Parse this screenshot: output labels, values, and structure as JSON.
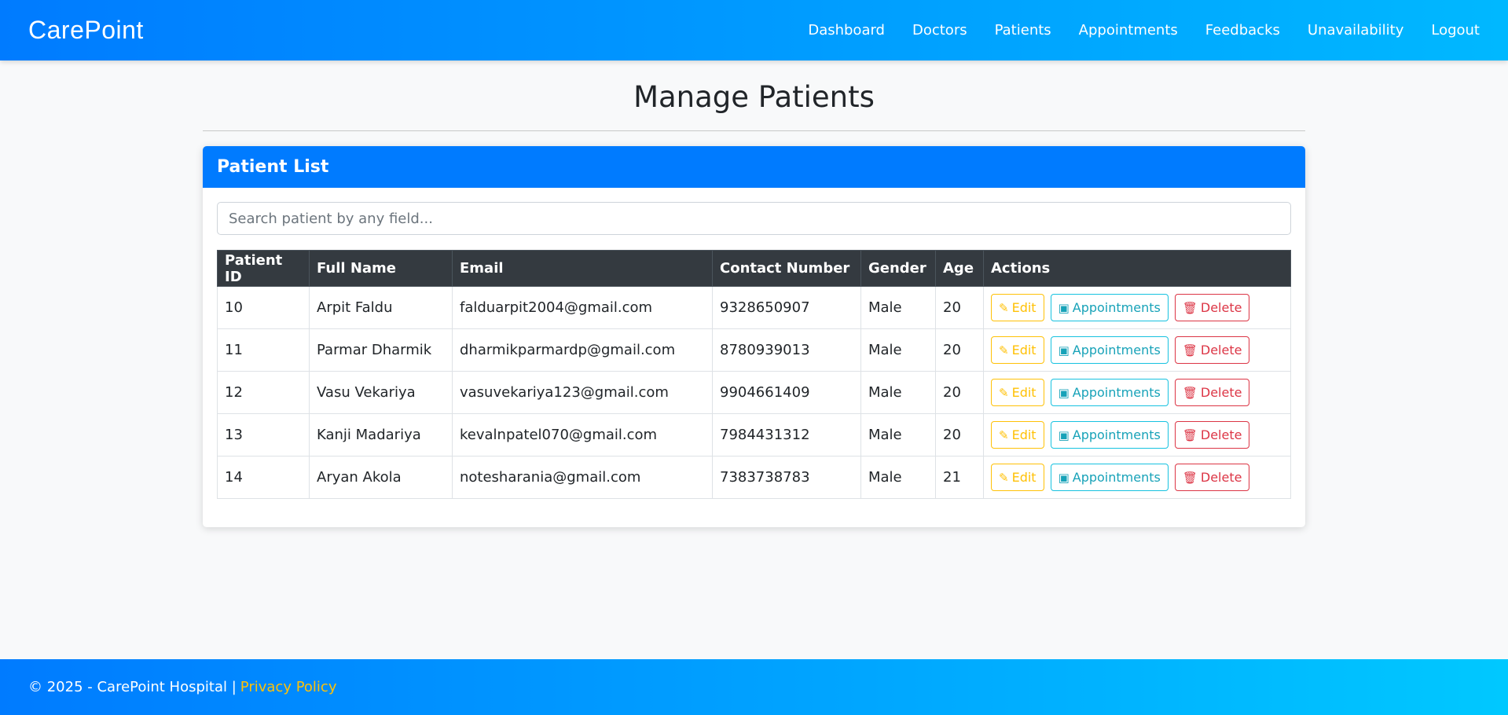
{
  "navbar": {
    "brand": "CarePoint",
    "links": [
      "Dashboard",
      "Doctors",
      "Patients",
      "Appointments",
      "Feedbacks",
      "Unavailability",
      "Logout"
    ]
  },
  "page": {
    "title": "Manage Patients"
  },
  "card": {
    "header": "Patient List",
    "search_placeholder": "Search patient by any field...",
    "search_value": ""
  },
  "table": {
    "columns": [
      "Patient ID",
      "Full Name",
      "Email",
      "Contact Number",
      "Gender",
      "Age",
      "Actions"
    ],
    "rows": [
      {
        "id": "10",
        "name": "Arpit Faldu",
        "email": "falduarpit2004@gmail.com",
        "contact": "9328650907",
        "gender": "Male",
        "age": "20"
      },
      {
        "id": "11",
        "name": "Parmar Dharmik",
        "email": "dharmikparmardp@gmail.com",
        "contact": "8780939013",
        "gender": "Male",
        "age": "20"
      },
      {
        "id": "12",
        "name": "Vasu Vekariya",
        "email": "vasuvekariya123@gmail.com",
        "contact": "9904661409",
        "gender": "Male",
        "age": "20"
      },
      {
        "id": "13",
        "name": "Kanji Madariya",
        "email": "kevalnpatel070@gmail.com",
        "contact": "7984431312",
        "gender": "Male",
        "age": "20"
      },
      {
        "id": "14",
        "name": "Aryan Akola",
        "email": "notesharania@gmail.com",
        "contact": "7383738783",
        "gender": "Male",
        "age": "21"
      }
    ],
    "actions": {
      "edit": "Edit",
      "appointments": "Appointments",
      "delete": "Delete"
    }
  },
  "icons": {
    "edit": "pencil-icon",
    "appointments": "calendar-check-icon",
    "delete": "trash-icon"
  },
  "footer": {
    "text": "© 2025 - CarePoint Hospital |",
    "link": "Privacy Policy"
  },
  "colors": {
    "primary": "#007bff",
    "table_header": "#343a40",
    "edit": "#ffc107",
    "appointments": "#17a2b8",
    "delete": "#dc3545"
  }
}
